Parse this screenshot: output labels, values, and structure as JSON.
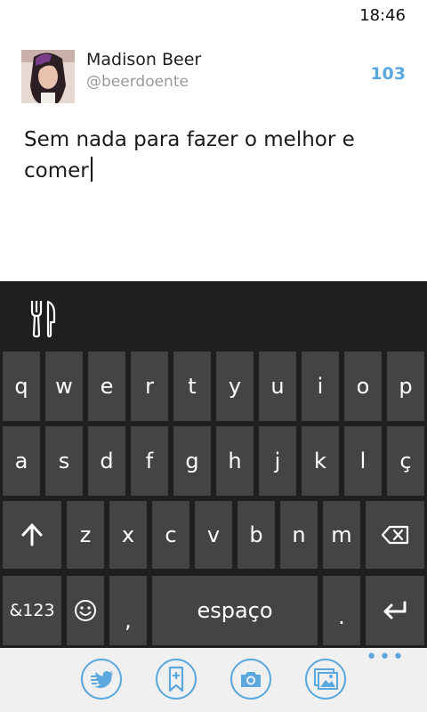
{
  "status": {
    "time": "18:46"
  },
  "account": {
    "name": "Madison Beer",
    "handle": "@beerdoente"
  },
  "compose": {
    "remaining_chars": "103",
    "text": "Sem nada para fazer o melhor e comer"
  },
  "keyboard": {
    "suggestion_icon": "fork-and-knife-icon",
    "row1": [
      "q",
      "w",
      "e",
      "r",
      "t",
      "y",
      "u",
      "i",
      "o",
      "p"
    ],
    "row2": [
      "a",
      "s",
      "d",
      "f",
      "g",
      "h",
      "j",
      "k",
      "l",
      "ç"
    ],
    "row3": [
      "z",
      "x",
      "c",
      "v",
      "b",
      "n",
      "m"
    ],
    "symbols_label": "&123",
    "comma_label": ",",
    "space_label": "espaço",
    "period_label": "."
  },
  "app_bar": {
    "more_label": "•••",
    "buttons": [
      "tweet-mention-icon",
      "add-location-icon",
      "camera-icon",
      "photo-gallery-icon"
    ]
  },
  "colors": {
    "accent": "#5aa8dd",
    "key": "#444444",
    "keyboard_bg": "#1f1f1f"
  }
}
